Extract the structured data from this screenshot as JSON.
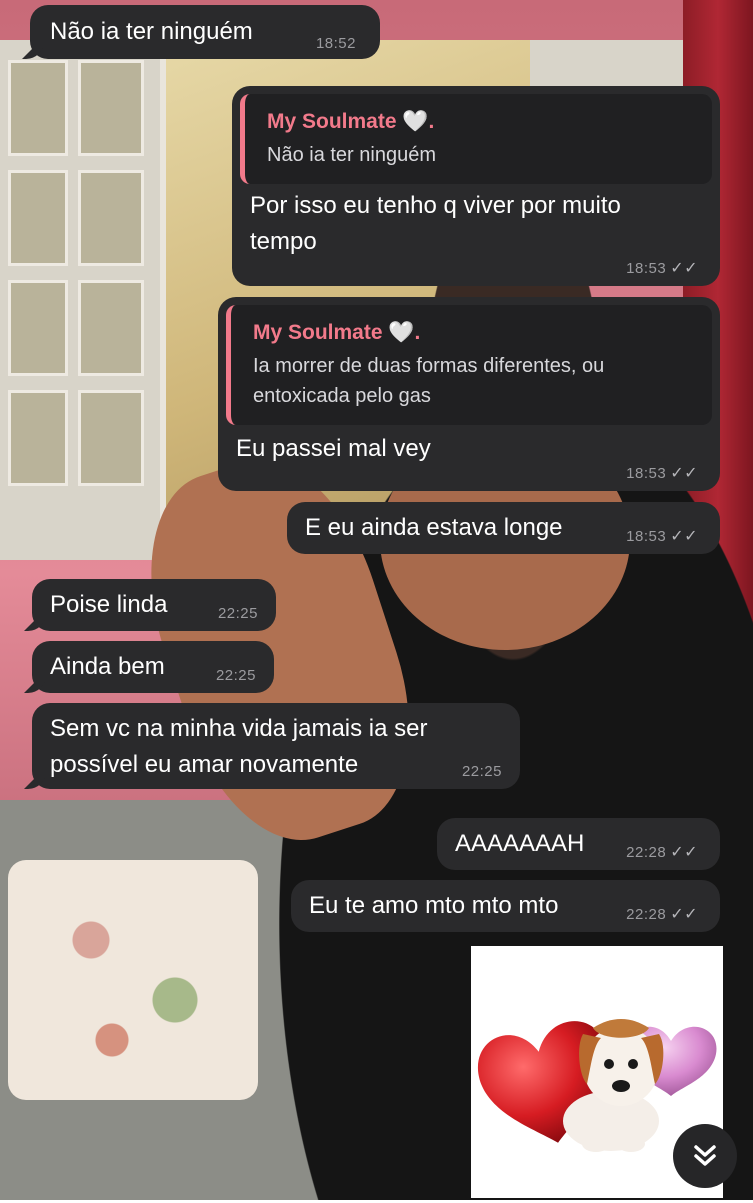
{
  "messages": [
    {
      "id": "m1",
      "direction": "incoming",
      "text": "Não ia ter ninguém",
      "time": "18:52"
    },
    {
      "id": "m2",
      "direction": "outgoing",
      "reply_to": {
        "name": "My Soulmate 🤍.",
        "text": "Não ia ter ninguém"
      },
      "text": "Por isso eu tenho q viver por muito tempo",
      "time": "18:53",
      "status": "read"
    },
    {
      "id": "m3",
      "direction": "outgoing",
      "reply_to": {
        "name": "My Soulmate 🤍.",
        "text": "Ia morrer de duas formas diferentes, ou entoxicada pelo gas"
      },
      "text": "Eu passei mal vey",
      "time": "18:53",
      "status": "read"
    },
    {
      "id": "m4",
      "direction": "outgoing",
      "text": "E eu ainda estava longe",
      "time": "18:53",
      "status": "read"
    },
    {
      "id": "m5",
      "direction": "incoming",
      "text": "Poise linda",
      "time": "22:25"
    },
    {
      "id": "m6",
      "direction": "incoming",
      "text": "Ainda bem",
      "time": "22:25"
    },
    {
      "id": "m7",
      "direction": "incoming",
      "text": "Sem vc na minha vida jamais ia ser possível eu amar novamente",
      "time": "22:25"
    },
    {
      "id": "m8",
      "direction": "outgoing",
      "text": "AAAAAAAH",
      "time": "22:28",
      "status": "read"
    },
    {
      "id": "m9",
      "direction": "outgoing",
      "text": "Eu te amo mto mto mto",
      "time": "22:28",
      "status": "read"
    }
  ],
  "sticker": {
    "icon": "puppy-hearts-sticker"
  },
  "scroll_button": {
    "icon": "double-chevron-down-icon"
  },
  "colors": {
    "bubble": "#2a2a2c",
    "quote_accent": "#f27a8b",
    "time": "#9b9b9f"
  }
}
